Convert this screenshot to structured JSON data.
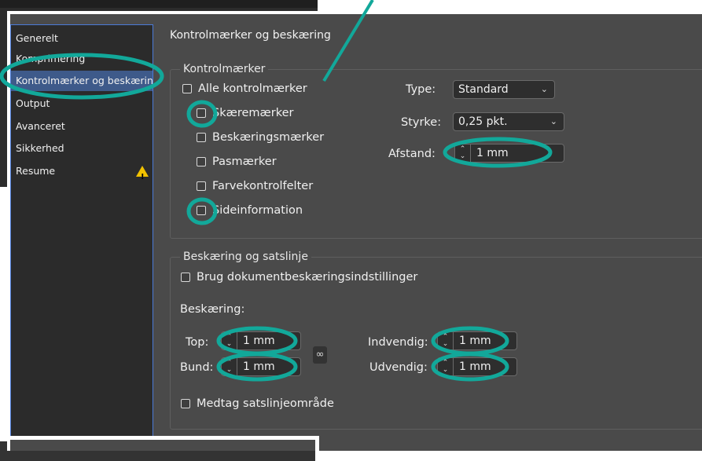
{
  "sidebar": {
    "items": [
      {
        "label": "Generelt"
      },
      {
        "label": "Komprimering"
      },
      {
        "label": "Kontrolmærker og beskæring"
      },
      {
        "label": "Output"
      },
      {
        "label": "Avanceret"
      },
      {
        "label": "Sikkerhed"
      },
      {
        "label": "Resume"
      }
    ],
    "warning_icon": "warning-icon"
  },
  "main": {
    "title": "Kontrolmærker og beskæring",
    "marks": {
      "legend": "Kontrolmærker",
      "all_marks": "Alle kontrolmærker",
      "crop_marks": "Skæremærker",
      "bleed_marks": "Beskæringsmærker",
      "registration_marks": "Pasmærker",
      "color_bars": "Farvekontrolfelter",
      "page_info": "Sideinformation",
      "type_label": "Type:",
      "type_value": "Standard",
      "weight_label": "Styrke:",
      "weight_value": "0,25 pkt.",
      "offset_label": "Afstand:",
      "offset_value": "1 mm"
    },
    "bleed": {
      "legend": "Beskæring og satslinje",
      "use_doc": "Brug dokumentbeskæringsindstillinger",
      "bleed_label": "Beskæring:",
      "top_label": "Top:",
      "top_value": "1 mm",
      "bottom_label": "Bund:",
      "bottom_value": "1 mm",
      "inside_label": "Indvendig:",
      "inside_value": "1 mm",
      "outside_label": "Udvendig:",
      "outside_value": "1 mm",
      "include_slug": "Medtag satslinjeområde"
    }
  },
  "colors": {
    "annotation": "#12a89a",
    "selection": "#3e5a8a",
    "panel": "#4a4a4a"
  }
}
